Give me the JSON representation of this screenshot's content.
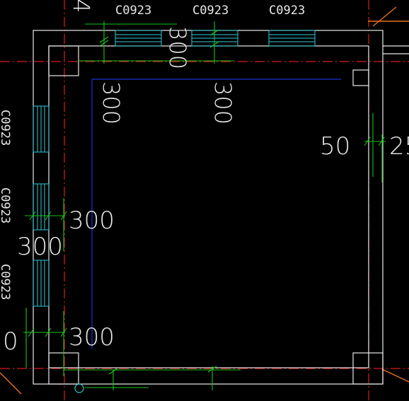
{
  "drawing": {
    "window_codes": {
      "top": [
        "C0923",
        "C0923",
        "C0923"
      ],
      "left": [
        "C0923",
        "C0923",
        "C0923"
      ]
    },
    "dimensions": {
      "top_vertical": "300",
      "left_top_vertical": "300",
      "center_top_vertical": "300",
      "right_value": "50",
      "right_value_clipped": "25",
      "left_mid_h": "300",
      "left_mid_lower": "300",
      "left_bottom_h": "300",
      "left_bottom_clipped": "0",
      "top_left_clipped": "4"
    },
    "colors": {
      "background": "#000000",
      "wall": "#e8e8e8",
      "axis": "#d81e1e",
      "dimension": "#19c419",
      "window": "#2ec8d6",
      "beam": "#1f2fd8",
      "highlight": "#e8741e"
    }
  }
}
